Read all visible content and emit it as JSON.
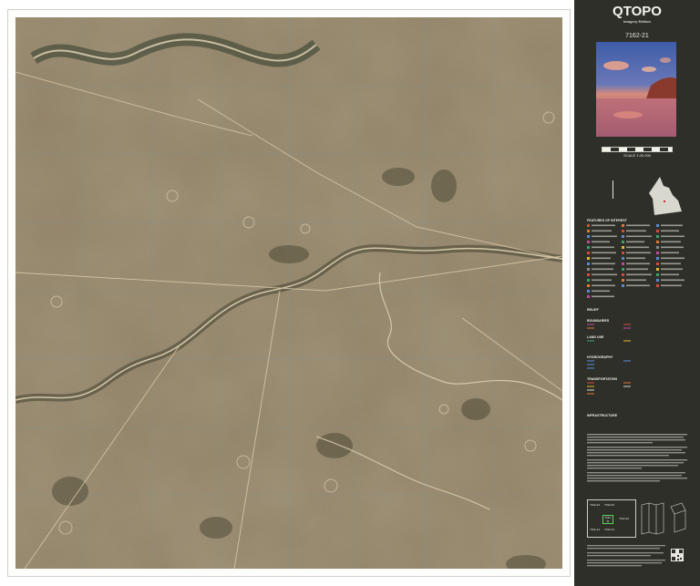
{
  "panel": {
    "title": "QTOPO",
    "subtitle": "Imagery Edition",
    "map_id": "7162-21",
    "scale_label": "SCALE 1:25 000"
  },
  "legend": {
    "reference_title": "FEATURES OF INTEREST",
    "sections": [
      "RELIEF",
      "BOUNDARIES",
      "LAND USE",
      "HYDROGRAPHY",
      "TRANSPORTATION",
      "INFRASTRUCTURE"
    ]
  },
  "index_sheets": [
    "7162-24",
    "7162-21",
    "7162-14",
    "7162-11",
    "7162-23",
    "7162-22",
    "7162-13",
    "7162-12"
  ],
  "colors": {
    "panel_bg": "#2e2f29",
    "map_ground": "#8a7a5e",
    "creek": "#c9bfa4",
    "road": "#d9c9a6",
    "veg": "#3d3a26"
  }
}
